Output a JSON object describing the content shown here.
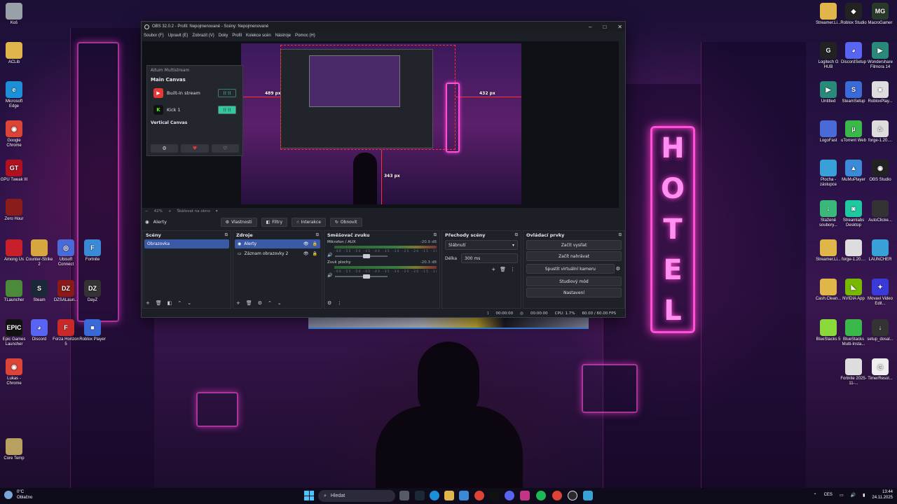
{
  "desktop": {
    "wallpaper_sign": [
      "H",
      "O",
      "T",
      "E",
      "L"
    ],
    "left_icons": [
      {
        "label": "Koš",
        "color": "#9aa0a8",
        "glyph": ""
      },
      {
        "label": "ACLib",
        "color": "#e0b54a",
        "glyph": ""
      },
      {
        "label": "Microsoft Edge",
        "color": "#1d8fd8",
        "glyph": "e"
      },
      {
        "label": "Google Chrome",
        "color": "#db4437",
        "glyph": "◉"
      },
      {
        "label": "GPU Tweak III",
        "color": "#b01020",
        "glyph": "GT"
      },
      {
        "label": "Zero Hour",
        "color": "#8a1c1c",
        "glyph": ""
      },
      {
        "label": "Among Us",
        "color": "#c8202a",
        "glyph": ""
      },
      {
        "label": "Counter-Strike 2",
        "color": "#d8a640",
        "glyph": ""
      },
      {
        "label": "Ubisoft Connect",
        "color": "#4a6ad8",
        "glyph": "◎"
      },
      {
        "label": "Fortnite",
        "color": "#3a8ad8",
        "glyph": "F"
      },
      {
        "label": "TLauncher",
        "color": "#4a8a3a",
        "glyph": ""
      },
      {
        "label": "Steam",
        "color": "#1b2838",
        "glyph": "S"
      },
      {
        "label": "DZSALaun...",
        "color": "#8a1a1a",
        "glyph": "DZ"
      },
      {
        "label": "DayZ",
        "color": "#333333",
        "glyph": "DZ"
      },
      {
        "label": "Epic Games Launcher",
        "color": "#111111",
        "glyph": "EPIC"
      },
      {
        "label": "Discord",
        "color": "#5865f2",
        "glyph": "◕"
      },
      {
        "label": "Forza Horizon 5",
        "color": "#c82a2a",
        "glyph": "F"
      },
      {
        "label": "Roblox Player",
        "color": "#3a6ad8",
        "glyph": "■"
      },
      {
        "label": "Lukas - Chrome",
        "color": "#db4437",
        "glyph": "◉"
      },
      {
        "label": "Core Temp",
        "color": "#b8a060",
        "glyph": ""
      }
    ],
    "right_icons": [
      {
        "label": "Streamer.Li...",
        "color": "#e0b54a",
        "glyph": ""
      },
      {
        "label": "Roblox Studio",
        "color": "#222222",
        "glyph": "◆"
      },
      {
        "label": "MacroGamer",
        "color": "#2a3a2a",
        "glyph": "MG"
      },
      {
        "label": "Logitech G HUB",
        "color": "#222222",
        "glyph": "G"
      },
      {
        "label": "DiscordSetup",
        "color": "#5865f2",
        "glyph": "◕"
      },
      {
        "label": "Wondershare Filmora 14",
        "color": "#2a8a7a",
        "glyph": "▶"
      },
      {
        "label": "Untitled",
        "color": "#2a8a7a",
        "glyph": "▶"
      },
      {
        "label": "SteamSetup",
        "color": "#3a6ad8",
        "glyph": "S"
      },
      {
        "label": "RobloxPlay...",
        "color": "#dddddd",
        "glyph": "■"
      },
      {
        "label": "LogoFast",
        "color": "#4a6ad8",
        "glyph": ""
      },
      {
        "label": "uTorrent Web",
        "color": "#3ab84a",
        "glyph": "µ"
      },
      {
        "label": "forge-1.20....",
        "color": "#dddddd",
        "glyph": "♨"
      },
      {
        "label": "Plocha - zástupce",
        "color": "#3aa0d8",
        "glyph": ""
      },
      {
        "label": "MuMuPlayer",
        "color": "#3a8ad8",
        "glyph": "▲"
      },
      {
        "label": "OBS Studio",
        "color": "#222222",
        "glyph": "◉"
      },
      {
        "label": "Stažené soubory...",
        "color": "#3ab87a",
        "glyph": "↓"
      },
      {
        "label": "Streamlabs Desktop",
        "color": "#20c8a0",
        "glyph": "◙"
      },
      {
        "label": "AutoClicke...",
        "color": "#333333",
        "glyph": ""
      },
      {
        "label": "Streamer.Li...",
        "color": "#e0b54a",
        "glyph": ""
      },
      {
        "label": "forge-1.20....",
        "color": "#dddddd",
        "glyph": ""
      },
      {
        "label": "LAUNCHER",
        "color": "#3aa0d8",
        "glyph": ""
      },
      {
        "label": "Cash.Clean...",
        "color": "#e0b54a",
        "glyph": ""
      },
      {
        "label": "NVIDIA App",
        "color": "#76b900",
        "glyph": "◣"
      },
      {
        "label": "Movavi Video Edit...",
        "color": "#3a3ad8",
        "glyph": "✦"
      },
      {
        "label": "BlueStacks 5",
        "color": "#8ad83a",
        "glyph": ""
      },
      {
        "label": "BlueStacks Multi-Insta...",
        "color": "#3ab84a",
        "glyph": ""
      },
      {
        "label": "setup_dosal...",
        "color": "#333333",
        "glyph": "↓"
      },
      {
        "label": "Fortnite 2025-11-...",
        "color": "#dddddd",
        "glyph": ""
      },
      {
        "label": "TimerResol...",
        "color": "#eeeeee",
        "glyph": "◷"
      }
    ]
  },
  "obs": {
    "title": "OBS 32.0.2 - Profil: Nepojmenované - Scény: Nepojmenované",
    "menu": [
      "Soubor (F)",
      "Upravit (E)",
      "Zobrazit (V)",
      "Doky",
      "Profil",
      "Kolekce scén",
      "Nástroje",
      "Pomoc (H)"
    ],
    "preview": {
      "px_left": "489 px",
      "px_right": "432 px",
      "px_bottom": "343 px",
      "zoom": "42%",
      "scale_mode": "Škálovat na okno"
    },
    "multiview": {
      "header": "Aitum Multistream",
      "main_canvas": "Main Canvas",
      "outputs": [
        {
          "name": "Built-in stream",
          "logo": "▶",
          "logo_bg": "#e53935",
          "state": "off"
        },
        {
          "name": "Kick 1",
          "logo": "K",
          "logo_bg": "#53fc18",
          "state": "on"
        }
      ],
      "vertical_canvas": "Vertical Canvas"
    },
    "source_toolbar": {
      "current_source": "Alerty",
      "buttons": [
        "Vlastnosti",
        "Filtry",
        "Interakce",
        "Obnovit"
      ]
    },
    "scenes": {
      "title": "Scény",
      "items": [
        "Obrazovka"
      ]
    },
    "sources": {
      "title": "Zdroje",
      "items": [
        "Alerty",
        "Záznam obrazovky 2"
      ]
    },
    "mixer": {
      "title": "Směšovač zvuku",
      "channels": [
        {
          "name": "Mikrofon / AUX",
          "db": "-20.9 dB",
          "fader": 0.6
        },
        {
          "name": "Zvuk plochy",
          "db": "-20.3 dB",
          "fader": 0.6
        }
      ],
      "ticks": "-60 -55 -50 -45 -40 -35 -30 -25 -20 -15 -10 -5 0"
    },
    "transitions": {
      "title": "Přechody scény",
      "transition": "Slábnutí",
      "duration_label": "Délka",
      "duration": "300 ms"
    },
    "controls": {
      "title": "Ovládací prvky",
      "buttons": [
        "Začít vysílat",
        "Začít nahrávat",
        "Spustit virtuální kameru",
        "Studiový mód",
        "Nastavení"
      ]
    },
    "status": {
      "stream_time": "00:00:00",
      "rec_time": "00:00:00",
      "cpu": "CPU: 1.7%",
      "fps": "60.00 / 60.00 FPS"
    }
  },
  "taskbar": {
    "weather_temp": "0°C",
    "weather_text": "Oblačno",
    "search_placeholder": "Hledat",
    "language": "CES",
    "time": "13:44",
    "date": "24.11.2025"
  }
}
